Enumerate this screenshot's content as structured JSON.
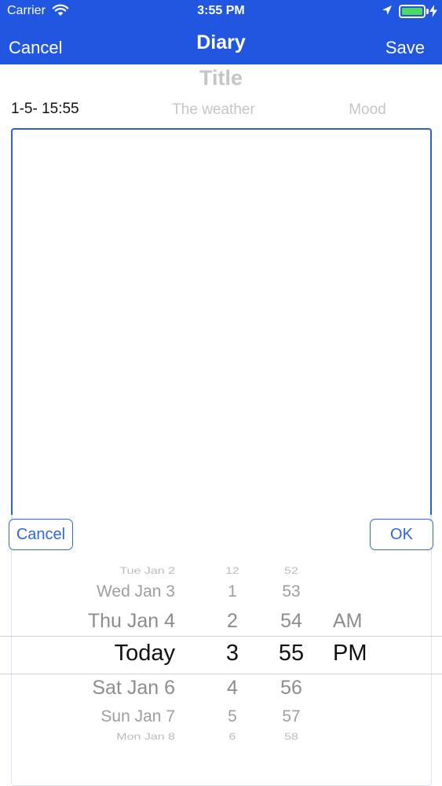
{
  "status_bar": {
    "carrier": "Carrier",
    "time": "3:55 PM",
    "battery_level": 1.0,
    "icons": [
      "wifi-icon",
      "location-arrow-icon",
      "battery-icon",
      "charging-bolt-icon"
    ]
  },
  "nav": {
    "cancel_label": "Cancel",
    "title": "Diary",
    "save_label": "Save",
    "bar_color": "#2157e0"
  },
  "form": {
    "title_placeholder": "Title",
    "date_text": "1-5- 15:55",
    "weather_placeholder": "The weather",
    "mood_placeholder": "Mood",
    "body_text": "",
    "border_color": "#2d5fce"
  },
  "picker": {
    "cancel_label": "Cancel",
    "ok_label": "OK",
    "accent_color": "#2f67d8",
    "dates": [
      "",
      "Tue Jan 2",
      "Wed Jan 3",
      "Thu Jan 4",
      "Today",
      "Sat Jan 6",
      "Sun Jan 7",
      "Mon Jan 8",
      ""
    ],
    "hours": [
      "",
      "12",
      "1",
      "2",
      "3",
      "4",
      "5",
      "6",
      ""
    ],
    "minutes": [
      "",
      "52",
      "53",
      "54",
      "55",
      "56",
      "57",
      "58",
      ""
    ],
    "ampm": [
      "AM",
      "PM"
    ],
    "selected": {
      "date": "Today",
      "hour": "3",
      "minute": "55",
      "period": "PM"
    }
  }
}
